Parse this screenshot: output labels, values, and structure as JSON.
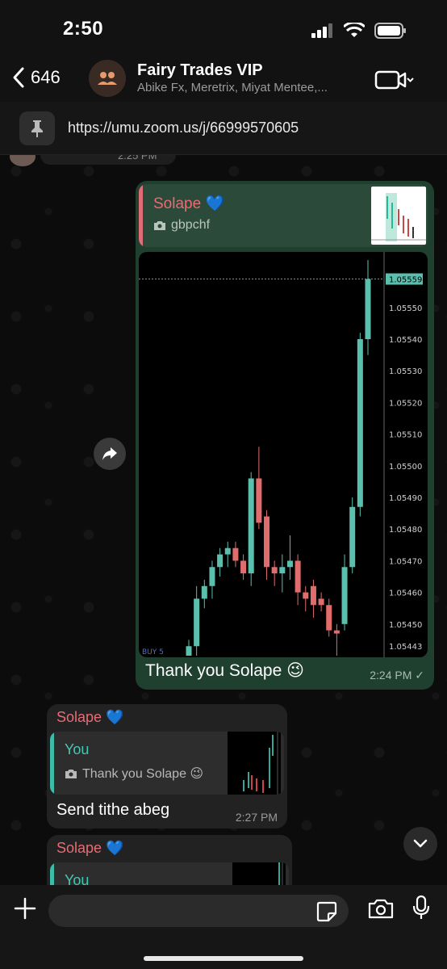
{
  "status_bar": {
    "time": "2:50"
  },
  "header": {
    "back_count": "646",
    "title": "Fairy Trades VIP",
    "subtitle": "Abike Fx, Meretrix, Miyat Mentee,..."
  },
  "pinned": {
    "link": "https://umu.zoom.us/j/66999570605"
  },
  "previous_message": {
    "time": "2:25 PM"
  },
  "outgoing_message": {
    "reply_to_name": "Solape 💙",
    "reply_to_text": "gbpchf",
    "caption": "Thank you Solape 😉",
    "time": "2:24 PM ✓"
  },
  "incoming_messages": [
    {
      "sender": "Solape 💙",
      "reply_to_name": "You",
      "reply_to_text": "Thank you Solape 😉",
      "text": "Send tithe abeg",
      "time": "2:27 PM"
    },
    {
      "sender": "Solape 💙",
      "reply_to_name": "You"
    }
  ],
  "chart_data": {
    "type": "candlestick",
    "price_labels": [
      "1.05559",
      "1.05550",
      "1.05540",
      "1.05530",
      "1.05520",
      "1.05510",
      "1.05500",
      "1.05490",
      "1.05480",
      "1.05470",
      "1.05460",
      "1.05450",
      "1.05443"
    ],
    "current_price": "1.05559",
    "bottom_left_label": "BUY 5",
    "ylim": [
      1.0544,
      1.05565
    ],
    "candles": [
      {
        "o": 1.0544,
        "c": 1.05443,
        "h": 1.05445,
        "l": 1.0544
      },
      {
        "o": 1.05443,
        "c": 1.05458,
        "h": 1.05462,
        "l": 1.0544
      },
      {
        "o": 1.05458,
        "c": 1.05462,
        "h": 1.05464,
        "l": 1.05455
      },
      {
        "o": 1.05462,
        "c": 1.05468,
        "h": 1.0547,
        "l": 1.05458
      },
      {
        "o": 1.05468,
        "c": 1.05472,
        "h": 1.05474,
        "l": 1.05465
      },
      {
        "o": 1.05472,
        "c": 1.05474,
        "h": 1.05476,
        "l": 1.05468
      },
      {
        "o": 1.05474,
        "c": 1.0547,
        "h": 1.05476,
        "l": 1.05468
      },
      {
        "o": 1.0547,
        "c": 1.05466,
        "h": 1.05472,
        "l": 1.05464
      },
      {
        "o": 1.05466,
        "c": 1.05496,
        "h": 1.05498,
        "l": 1.05462
      },
      {
        "o": 1.05496,
        "c": 1.05482,
        "h": 1.05506,
        "l": 1.0548
      },
      {
        "o": 1.05484,
        "c": 1.05468,
        "h": 1.05486,
        "l": 1.05464
      },
      {
        "o": 1.05468,
        "c": 1.05466,
        "h": 1.0547,
        "l": 1.05462
      },
      {
        "o": 1.05466,
        "c": 1.05468,
        "h": 1.05472,
        "l": 1.0546
      },
      {
        "o": 1.05468,
        "c": 1.0547,
        "h": 1.05478,
        "l": 1.05464
      },
      {
        "o": 1.0547,
        "c": 1.0546,
        "h": 1.05472,
        "l": 1.05456
      },
      {
        "o": 1.0546,
        "c": 1.05458,
        "h": 1.05462,
        "l": 1.05454
      },
      {
        "o": 1.05462,
        "c": 1.05456,
        "h": 1.05464,
        "l": 1.05452
      },
      {
        "o": 1.05458,
        "c": 1.05456,
        "h": 1.0546,
        "l": 1.05454
      },
      {
        "o": 1.05456,
        "c": 1.05448,
        "h": 1.05458,
        "l": 1.05446
      },
      {
        "o": 1.05448,
        "c": 1.05447,
        "h": 1.0545,
        "l": 1.0544
      },
      {
        "o": 1.0545,
        "c": 1.05468,
        "h": 1.05472,
        "l": 1.05448
      },
      {
        "o": 1.05468,
        "c": 1.05487,
        "h": 1.0549,
        "l": 1.05466
      },
      {
        "o": 1.05487,
        "c": 1.0554,
        "h": 1.05542,
        "l": 1.05484
      },
      {
        "o": 1.0554,
        "c": 1.05559,
        "h": 1.05565,
        "l": 1.05535
      }
    ]
  }
}
